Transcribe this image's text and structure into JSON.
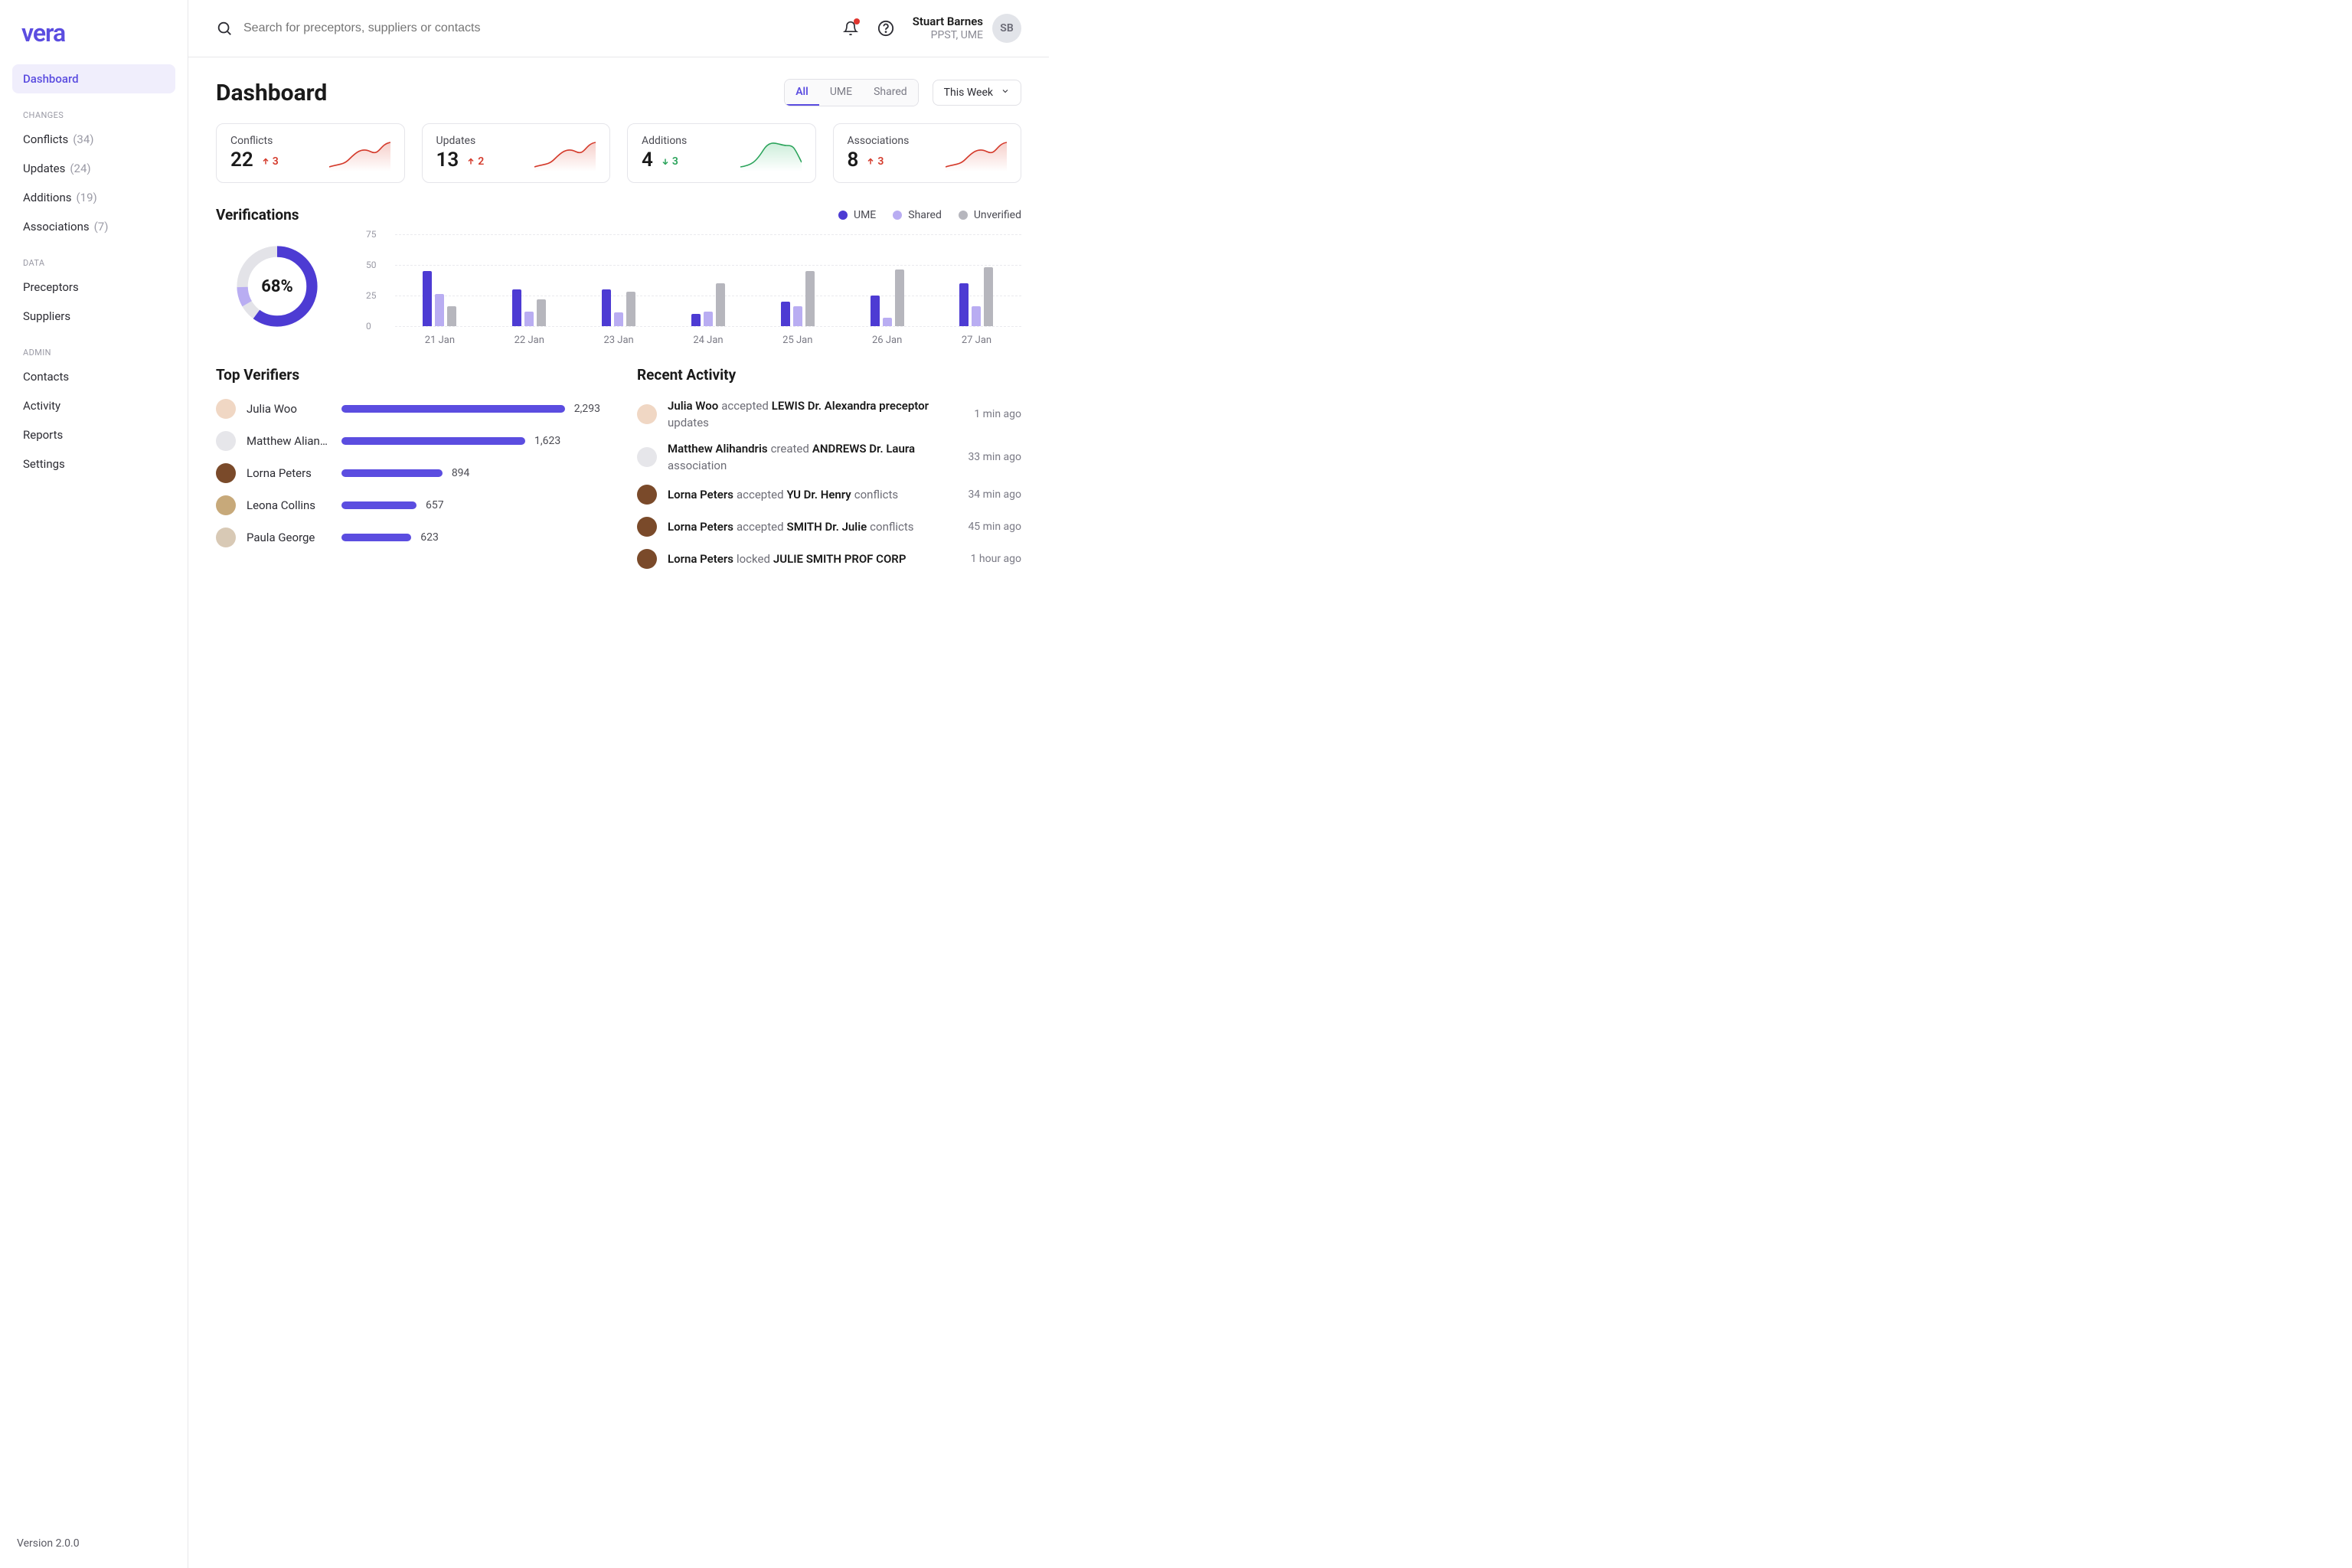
{
  "brand": "vera",
  "version": "Version 2.0.0",
  "sidebar": {
    "active": "Dashboard",
    "sections": [
      {
        "label": "",
        "items": [
          {
            "label": "Dashboard",
            "count": null
          }
        ]
      },
      {
        "label": "CHANGES",
        "items": [
          {
            "label": "Conflicts",
            "count": "(34)"
          },
          {
            "label": "Updates",
            "count": "(24)"
          },
          {
            "label": "Additions",
            "count": "(19)"
          },
          {
            "label": "Associations",
            "count": "(7)"
          }
        ]
      },
      {
        "label": "DATA",
        "items": [
          {
            "label": "Preceptors",
            "count": null
          },
          {
            "label": "Suppliers",
            "count": null
          }
        ]
      },
      {
        "label": "ADMIN",
        "items": [
          {
            "label": "Contacts",
            "count": null
          },
          {
            "label": "Activity",
            "count": null
          },
          {
            "label": "Reports",
            "count": null
          },
          {
            "label": "Settings",
            "count": null
          }
        ]
      }
    ]
  },
  "search_placeholder": "Search for preceptors, suppliers or contacts",
  "user": {
    "name": "Stuart Barnes",
    "role": "PPST, UME"
  },
  "page_title": "Dashboard",
  "filter_tabs": [
    "All",
    "UME",
    "Shared"
  ],
  "filter_active": "All",
  "range_selected": "This Week",
  "stats": [
    {
      "label": "Conflicts",
      "value": "22",
      "delta": "3",
      "direction": "up",
      "delta_color": "red"
    },
    {
      "label": "Updates",
      "value": "13",
      "delta": "2",
      "direction": "up",
      "delta_color": "red"
    },
    {
      "label": "Additions",
      "value": "4",
      "delta": "3",
      "direction": "down",
      "delta_color": "green"
    },
    {
      "label": "Associations",
      "value": "8",
      "delta": "3",
      "direction": "up",
      "delta_color": "red"
    }
  ],
  "verifications_title": "Verifications",
  "legend": {
    "ume": "UME",
    "shared": "Shared",
    "unverified": "Unverified"
  },
  "donut_percent": "68%",
  "chart_data": {
    "type": "bar",
    "categories": [
      "21 Jan",
      "22 Jan",
      "23 Jan",
      "24 Jan",
      "25 Jan",
      "26 Jan",
      "27 Jan"
    ],
    "series": [
      {
        "name": "UME",
        "values": [
          45,
          30,
          30,
          10,
          20,
          25,
          35
        ]
      },
      {
        "name": "Shared",
        "values": [
          26,
          12,
          11,
          12,
          16,
          7,
          16
        ]
      },
      {
        "name": "Unverified",
        "values": [
          16,
          22,
          28,
          35,
          45,
          46,
          48
        ]
      }
    ],
    "ylim": [
      0,
      75
    ],
    "y_ticks": [
      0,
      25,
      50,
      75
    ],
    "legend_position": "top-right"
  },
  "top_verifiers_title": "Top Verifiers",
  "top_verifiers_max": 2293,
  "top_verifiers": [
    {
      "name": "Julia Woo",
      "count": 2293,
      "count_label": "2,293",
      "avatar": "#f0d7c4"
    },
    {
      "name": "Matthew Aliandr...",
      "count": 1623,
      "count_label": "1,623",
      "avatar": "#e6e6ea"
    },
    {
      "name": "Lorna Peters",
      "count": 894,
      "count_label": "894",
      "avatar": "#7a4a2a"
    },
    {
      "name": "Leona Collins",
      "count": 657,
      "count_label": "657",
      "avatar": "#c7a97a"
    },
    {
      "name": "Paula George",
      "count": 623,
      "count_label": "623",
      "avatar": "#d8c9b5"
    }
  ],
  "recent_title": "Recent Activity",
  "recent": [
    {
      "actor": "Julia Woo",
      "verb": "accepted",
      "subject": "LEWIS Dr. Alexandra preceptor",
      "tail": "updates",
      "time": "1 min ago",
      "avatar": "#f0d7c4"
    },
    {
      "actor": "Matthew Alihandris",
      "verb": "created",
      "subject": "ANDREWS Dr. Laura",
      "tail": "association",
      "time": "33 min ago",
      "avatar": "#e6e6ea"
    },
    {
      "actor": "Lorna Peters",
      "verb": "accepted",
      "subject": "YU Dr. Henry",
      "tail": "conflicts",
      "time": "34 min ago",
      "avatar": "#7a4a2a"
    },
    {
      "actor": "Lorna Peters",
      "verb": "accepted",
      "subject": "SMITH Dr. Julie",
      "tail": "conflicts",
      "time": "45 min ago",
      "avatar": "#7a4a2a"
    },
    {
      "actor": "Lorna Peters",
      "verb": "locked",
      "subject": "JULIE SMITH PROF CORP",
      "tail": "",
      "time": "1 hour ago",
      "avatar": "#7a4a2a"
    }
  ]
}
